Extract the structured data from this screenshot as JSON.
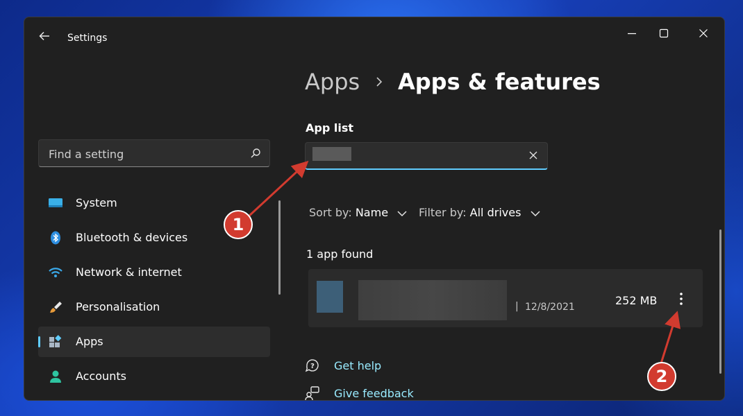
{
  "window": {
    "title": "Settings"
  },
  "sidebar": {
    "search_placeholder": "Find a setting",
    "items": [
      {
        "label": "System",
        "icon": "monitor-icon"
      },
      {
        "label": "Bluetooth & devices",
        "icon": "bluetooth-icon"
      },
      {
        "label": "Network & internet",
        "icon": "wifi-icon"
      },
      {
        "label": "Personalisation",
        "icon": "brush-icon"
      },
      {
        "label": "Apps",
        "icon": "apps-icon",
        "active": true
      },
      {
        "label": "Accounts",
        "icon": "person-icon"
      }
    ]
  },
  "breadcrumb": {
    "parent": "Apps",
    "current": "Apps & features"
  },
  "app_list": {
    "label": "App list",
    "sort_label": "Sort by:",
    "sort_value": "Name",
    "filter_label": "Filter by:",
    "filter_value": "All drives",
    "count_text": "1 app found",
    "apps": [
      {
        "separator": "|",
        "date": "12/8/2021",
        "size": "252 MB"
      }
    ]
  },
  "links": {
    "get_help": "Get help",
    "give_feedback": "Give feedback"
  },
  "annotations": [
    {
      "label": "1"
    },
    {
      "label": "2"
    }
  ],
  "colors": {
    "accent": "#60cdff",
    "link": "#99ebff",
    "annotation": "#d23b2f",
    "window_bg": "#202020"
  }
}
